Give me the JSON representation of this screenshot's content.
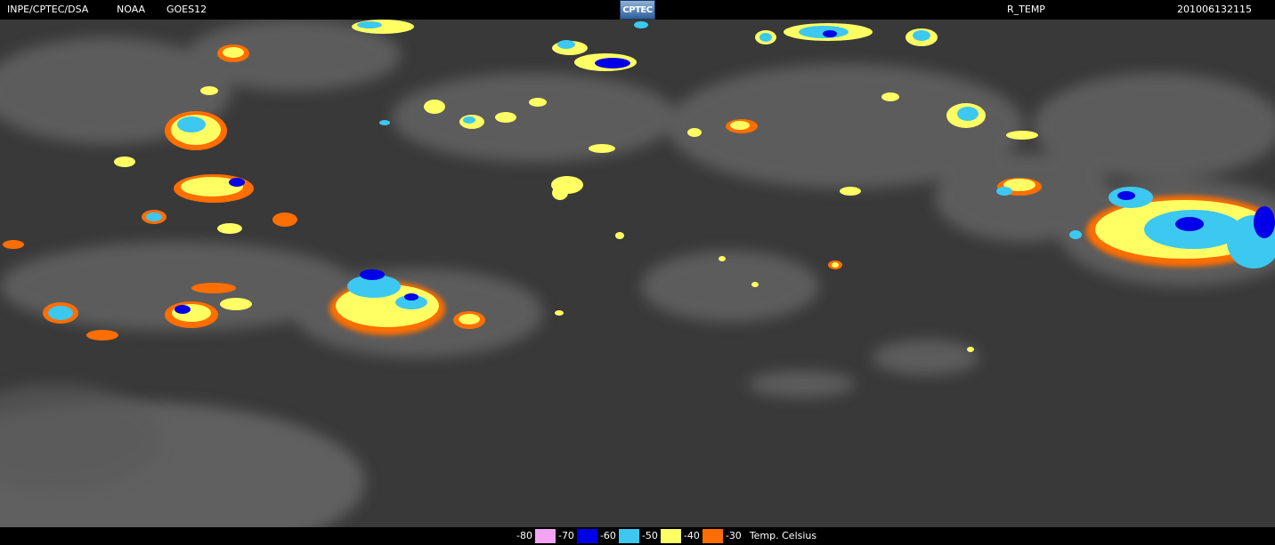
{
  "header": {
    "agency": "INPE/CPTEC/DSA",
    "noaa": "NOAA",
    "satellite": "GOES12",
    "logo_text": "CPTEC",
    "product": "R_TEMP",
    "timestamp": "201006132115"
  },
  "legend": {
    "items": [
      {
        "label": "-80",
        "color": "#f4a4f4"
      },
      {
        "label": "-70",
        "color": "#0000e8"
      },
      {
        "label": "-60",
        "color": "#3cc8f0"
      },
      {
        "label": "-50",
        "color": "#ffff64"
      },
      {
        "label": "-40",
        "color": "#ff6e00"
      },
      {
        "label": "-30",
        "color": null
      }
    ],
    "caption": "Temp. Celsius"
  },
  "colors": {
    "background": "#000000",
    "land": "#3a3a3a",
    "cloud": "#8a8a8a"
  }
}
